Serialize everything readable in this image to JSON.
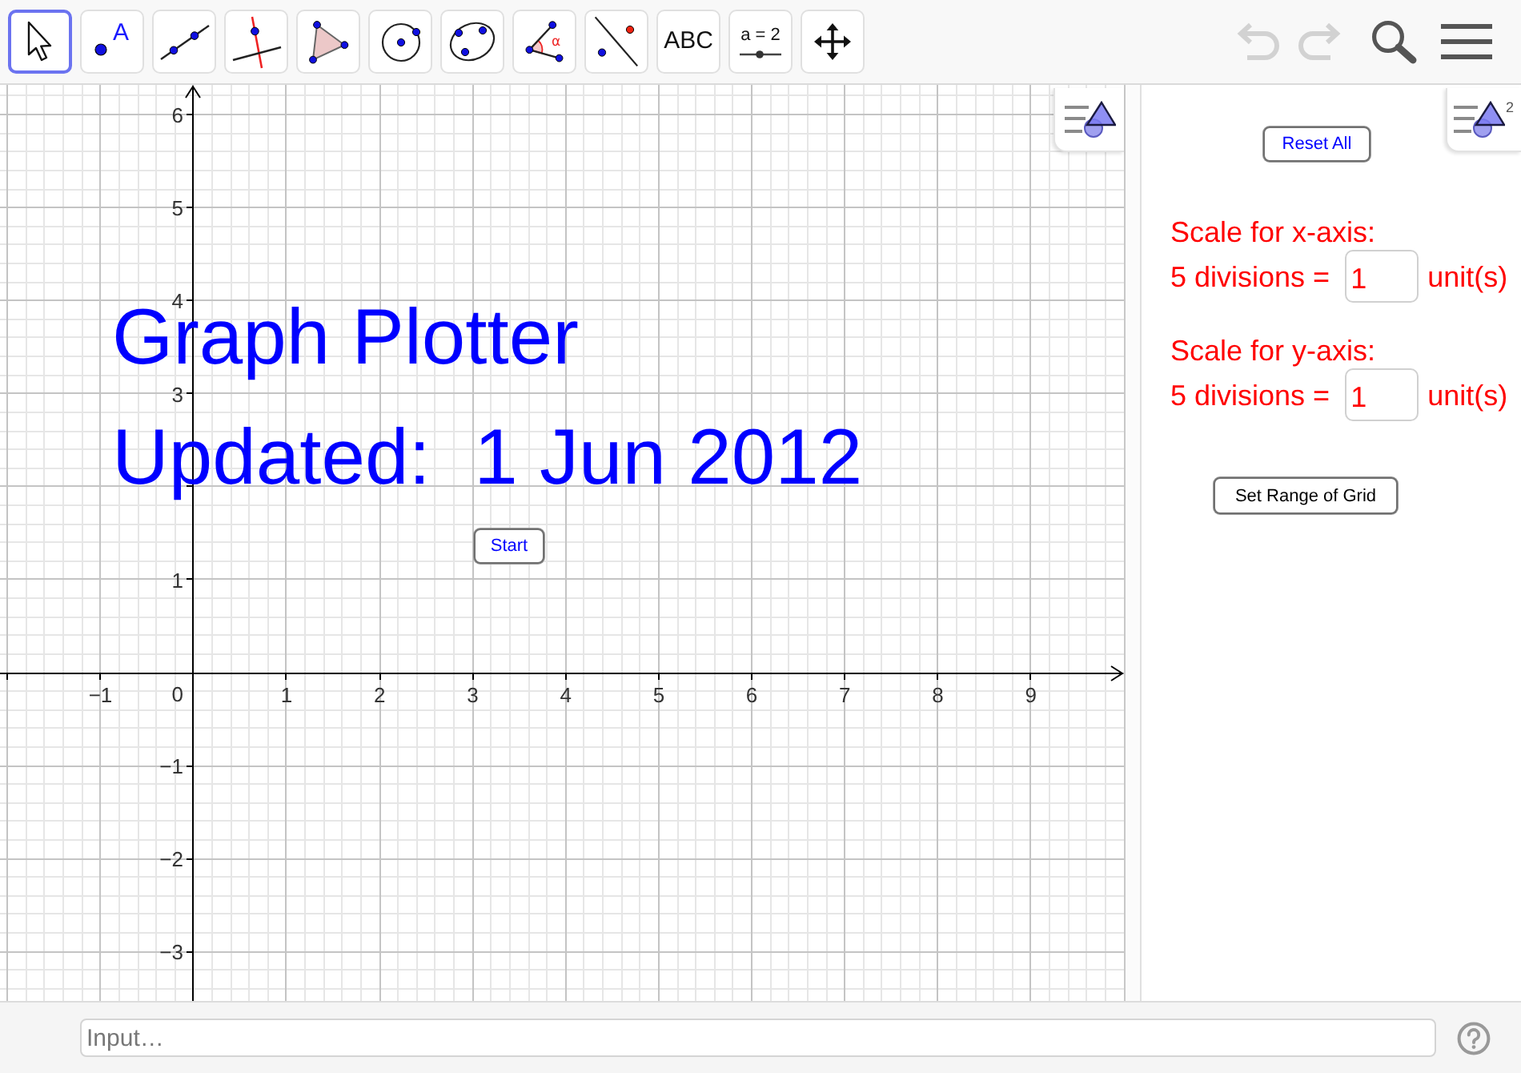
{
  "toolbar": {
    "tools": [
      {
        "kind": "move",
        "selected": true
      },
      {
        "kind": "point",
        "glyph": "A",
        "selected": false
      },
      {
        "kind": "line",
        "selected": false
      },
      {
        "kind": "perpendicular",
        "selected": false
      },
      {
        "kind": "polygon",
        "selected": false
      },
      {
        "kind": "circle",
        "selected": false
      },
      {
        "kind": "conic",
        "selected": false
      },
      {
        "kind": "angle",
        "glyph": "α",
        "selected": false
      },
      {
        "kind": "reflect",
        "selected": false
      },
      {
        "kind": "text",
        "glyph": "ABC",
        "selected": false
      },
      {
        "kind": "slider",
        "glyph": "a = 2",
        "selected": false
      },
      {
        "kind": "move_view",
        "selected": false
      }
    ],
    "undo": {
      "disabled": true
    },
    "redo": {
      "disabled": true
    }
  },
  "graphics": {
    "chart_data": {
      "type": "scatter",
      "grid": true,
      "xlim": [
        -2.08,
        10
      ],
      "ylim": [
        -3.53,
        6.32
      ],
      "xticks": [
        {
          "value": -1,
          "label": "−1"
        },
        1,
        2,
        3,
        4,
        5,
        6,
        7,
        8,
        9
      ],
      "yticks": [
        {
          "value": -3,
          "label": "−3"
        },
        {
          "value": -2,
          "label": "−2"
        },
        {
          "value": -1,
          "label": "−1"
        },
        1,
        3,
        4,
        5,
        6
      ]
    },
    "origin_label": "0",
    "texts": [
      "Graph Plotter",
      "Updated:  1 Jun 2012"
    ],
    "start_button": "Start"
  },
  "graphics_2": {
    "view_number": "2",
    "reset_button": "Reset All",
    "scales": [
      {
        "heading": "Scale for x-axis:",
        "prefix": "5 divisions =",
        "value": "1",
        "suffix": "unit(s)"
      },
      {
        "heading": "Scale for y-axis:",
        "prefix": "5 divisions =",
        "value": "1",
        "suffix": "unit(s)"
      }
    ],
    "range_button": "Set Range of Grid"
  },
  "input_bar": {
    "placeholder": "Input…"
  }
}
